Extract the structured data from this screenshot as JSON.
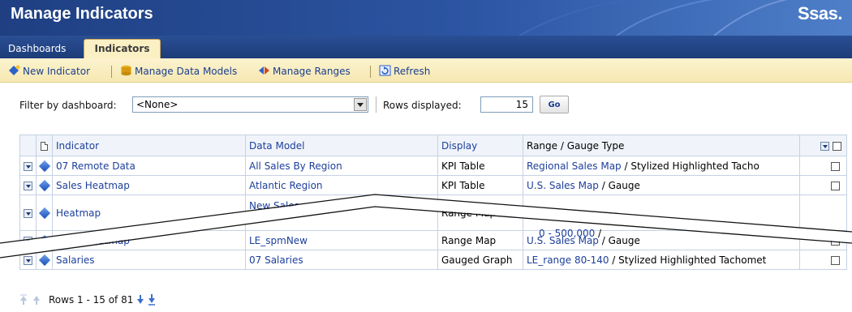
{
  "banner": {
    "title": "Manage Indicators",
    "logo_text": "Ssas."
  },
  "tabs": [
    {
      "label": "Dashboards"
    },
    {
      "label": "Indicators"
    }
  ],
  "toolbar": {
    "new_indicator": "New Indicator",
    "manage_data_models": "Manage Data Models",
    "manage_ranges": "Manage Ranges",
    "refresh": "Refresh"
  },
  "filter": {
    "label": "Filter by dashboard:",
    "selected": "<None>",
    "rows_label": "Rows displayed:",
    "rows_value": "15",
    "go_label": "Go"
  },
  "grid": {
    "headers": {
      "indicator": "Indicator",
      "data_model": "Data Model",
      "display": "Display",
      "range_gauge": "Range / Gauge Type"
    },
    "rows": [
      {
        "indicator": "07 Remote Data",
        "data_model": "All Sales By Region",
        "display": "KPI Table",
        "range": "Regional Sales Map",
        "gauge": " / Stylized Highlighted Tacho"
      },
      {
        "indicator": "Sales Heatmap",
        "data_model": "Atlantic Region",
        "display": "KPI Table",
        "range": "U.S. Sales Map",
        "gauge": " / Gauge"
      },
      {
        "indicator": "Heatmap",
        "data_model": "New Sales",
        "display": "Range Map",
        "range": "0 - 500,000",
        "gauge": " /"
      },
      {
        "indicator": "Sales Heatmap",
        "data_model": "LE_spmNew",
        "display": "Range Map",
        "range": "U.S. Sales Map",
        "gauge": "  / Gauge"
      },
      {
        "indicator": "Salaries",
        "data_model": "07 Salaries",
        "display": "Gauged Graph",
        "range": "LE_range 80-140",
        "gauge": " / Stylized Highlighted Tachomet"
      }
    ]
  },
  "pager": {
    "text": "Rows 1 - 15 of 81"
  },
  "colors": {
    "banner": "#2c55a2",
    "tab_active": "#fbf0c4",
    "toolbar": "#f6e8b1",
    "link": "#1d3f9b"
  }
}
